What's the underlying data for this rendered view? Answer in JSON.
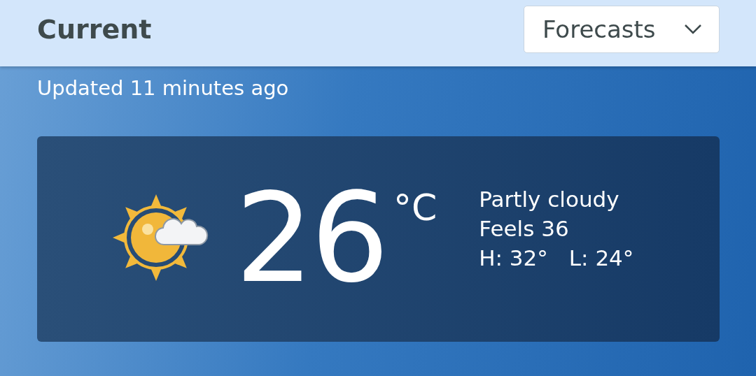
{
  "header": {
    "title": "Current",
    "dropdown": {
      "label": "Forecasts"
    }
  },
  "updated": "Updated 11 minutes ago",
  "card": {
    "temperature": "26",
    "unit": "°C",
    "condition": "Partly cloudy",
    "feels": "Feels 36",
    "high": "H: 32°",
    "low": "L: 24°"
  }
}
